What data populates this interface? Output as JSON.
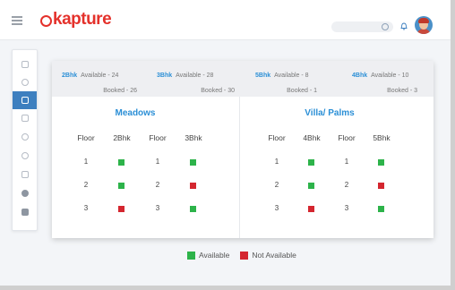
{
  "app": {
    "brand": "kapture"
  },
  "summary": [
    {
      "name": "2Bhk",
      "available": "Available - 24",
      "booked": "Booked - 26"
    },
    {
      "name": "3Bhk",
      "available": "Available - 28",
      "booked": "Booked - 30"
    },
    {
      "name": "5Bhk",
      "available": "Available - 8",
      "booked": "Booked - 1"
    },
    {
      "name": "4Bhk",
      "available": "Available - 10",
      "booked": "Booked - 3"
    }
  ],
  "meadows": {
    "title": "Meadows",
    "headers": [
      "Floor",
      "2Bhk",
      "Floor",
      "3Bhk"
    ],
    "rows": [
      {
        "floor_a": "1",
        "a": "available",
        "floor_b": "1",
        "b": "available"
      },
      {
        "floor_a": "2",
        "a": "available",
        "floor_b": "2",
        "b": "not-available"
      },
      {
        "floor_a": "3",
        "a": "not-available",
        "floor_b": "3",
        "b": "available"
      }
    ]
  },
  "villa": {
    "title": "Villa/ Palms",
    "headers": [
      "Floor",
      "4Bhk",
      "Floor",
      "5Bhk"
    ],
    "rows": [
      {
        "floor_a": "1",
        "a": "available",
        "floor_b": "1",
        "b": "available"
      },
      {
        "floor_a": "2",
        "a": "available",
        "floor_b": "2",
        "b": "not-available"
      },
      {
        "floor_a": "3",
        "a": "not-available",
        "floor_b": "3",
        "b": "available"
      }
    ]
  },
  "legend": {
    "available": "Available",
    "not_available": "Not Available"
  },
  "colors": {
    "available": "#2db34a",
    "not_available": "#d4262f",
    "accent": "#2b8fd6",
    "brand": "#e4312b"
  },
  "sidebar": {
    "icons": [
      "home-icon",
      "user-icon",
      "document-icon",
      "edit-icon",
      "group-icon",
      "settings-icon",
      "monitor-icon",
      "upload-icon",
      "save-icon"
    ],
    "active_index": 2
  }
}
